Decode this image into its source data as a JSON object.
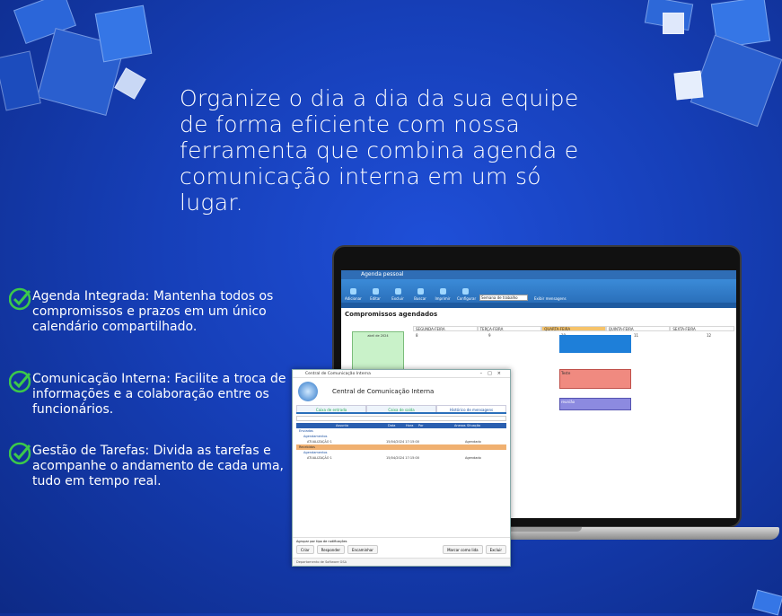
{
  "heading": "Organize o dia a dia da sua equipe de forma eficiente com nossa ferramenta que combina agenda e comunicação interna em um só lugar.",
  "features": [
    {
      "text": "Agenda Integrada: Mantenha todos os compromissos e prazos em um único calendário compartilhado."
    },
    {
      "text": "Comunicação Interna: Facilite a troca de informações e a colaboração entre os funcionários."
    },
    {
      "text": "Gestão de Tarefas: Divida as tarefas e acompanhe o andamento de cada uma, tudo em tempo real."
    }
  ],
  "agenda": {
    "window_title": "Agenda pessoal",
    "ribbon": [
      "Adicionar",
      "Editar",
      "Excluir",
      "Buscar",
      "Imprimir",
      "Configurar"
    ],
    "select_value": "Semana de trabalho",
    "filter_label": "Exibir mensagens",
    "section_title": "Compromissos agendados",
    "mini_month": "abril de 2024",
    "days": [
      "SEGUNDA-FEIRA",
      "TERÇA-FEIRA",
      "QUARTA-FEIRA",
      "QUINTA-FEIRA",
      "SEXTA-FEIRA"
    ],
    "day_nums": [
      "8",
      "9",
      "10",
      "11",
      "12"
    ],
    "events": [
      "Teste",
      "reunião"
    ]
  },
  "dialog": {
    "title": "Central de Comunicação Interna",
    "header": "Central de Comunicação Interna",
    "tabs": [
      "Caixa de entrada",
      "Caixa de saída",
      "Histórico de mensagens"
    ],
    "columns": [
      "Assunto",
      "Data",
      "Hora",
      "Por",
      "Anexos",
      "Situação"
    ],
    "groups": [
      "Enviadas",
      "Recebidas"
    ],
    "subgroup": "Agendamentos",
    "item_label": "ATUALIZAÇÃO 1",
    "item_date": "15/04/2024 17:15:00",
    "item_status": "Agendado",
    "footer_label": "Agrupar por tipo de notificações",
    "buttons": [
      "Criar",
      "Responder",
      "Encaminhar",
      "Marcar como lida",
      "Excluir"
    ],
    "status": "Departamento de Software GSA"
  }
}
